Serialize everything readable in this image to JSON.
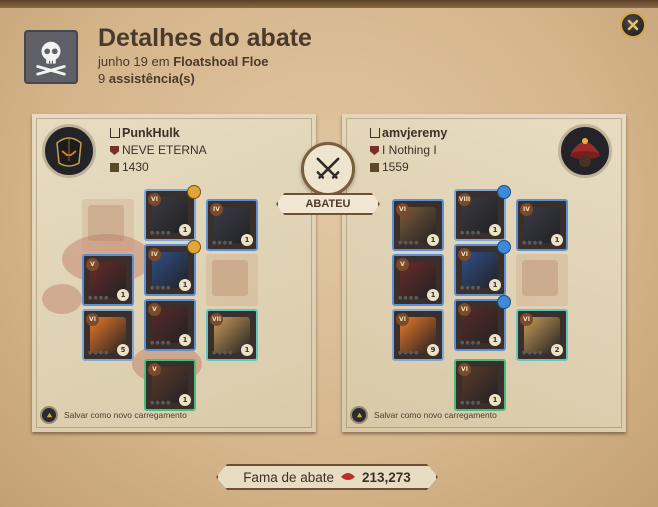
{
  "header": {
    "title": "Detalhes do abate",
    "date": "junho 19 em",
    "location": "Floatshoal Floe",
    "assist_count": "9",
    "assist_label": "assistência(s)"
  },
  "killer": {
    "name": "PunkHulk",
    "guild": "NEVE ETERNA",
    "item_power": "1430",
    "save_loadout": "Salvar como novo carregamento"
  },
  "victim": {
    "name": "amvjeremy",
    "guild": "I Nothing I",
    "item_power": "1559",
    "save_loadout": "Salvar como novo carregamento"
  },
  "center": {
    "label": "ABATEU"
  },
  "footer": {
    "fame_label": "Fama de abate",
    "fame_value": "213,273"
  },
  "colors": {
    "accent": "#d7a73a",
    "text": "#4a3a2c",
    "fame_icon": "#b8302a"
  },
  "icons": [
    "close-icon",
    "skull-crossbones-icon",
    "swords-icon",
    "ip-icon",
    "guild-icon",
    "save-icon",
    "blood-drop-icon"
  ],
  "killer_items": [
    {
      "slot": "bag",
      "empty": true
    },
    {
      "slot": "head",
      "qty": "1",
      "tier": "VI"
    },
    {
      "slot": "cape",
      "qty": "1",
      "tier": "IV"
    },
    {
      "slot": "mainhand",
      "qty": "1",
      "tier": "V"
    },
    {
      "slot": "armor",
      "qty": "1",
      "tier": "IV"
    },
    {
      "slot": "offhand",
      "empty": true
    },
    {
      "slot": "potion",
      "qty": "5",
      "tier": "VI"
    },
    {
      "slot": "shoes",
      "qty": "1",
      "tier": "V"
    },
    {
      "slot": "food",
      "qty": "1",
      "tier": "VII"
    },
    {
      "slot": "mount",
      "qty": "1",
      "tier": "V"
    }
  ],
  "victim_items": [
    {
      "slot": "bag",
      "qty": "1",
      "tier": "VI"
    },
    {
      "slot": "head",
      "qty": "1",
      "tier": "VIII"
    },
    {
      "slot": "cape",
      "qty": "1",
      "tier": "IV"
    },
    {
      "slot": "mainhand",
      "qty": "1",
      "tier": "V"
    },
    {
      "slot": "armor",
      "qty": "1",
      "tier": "VI"
    },
    {
      "slot": "offhand",
      "empty": true
    },
    {
      "slot": "potion",
      "qty": "9",
      "tier": "VI"
    },
    {
      "slot": "shoes",
      "qty": "1",
      "tier": "VI"
    },
    {
      "slot": "food",
      "qty": "2",
      "tier": "VI"
    },
    {
      "slot": "mount",
      "qty": "1",
      "tier": "VI"
    }
  ]
}
